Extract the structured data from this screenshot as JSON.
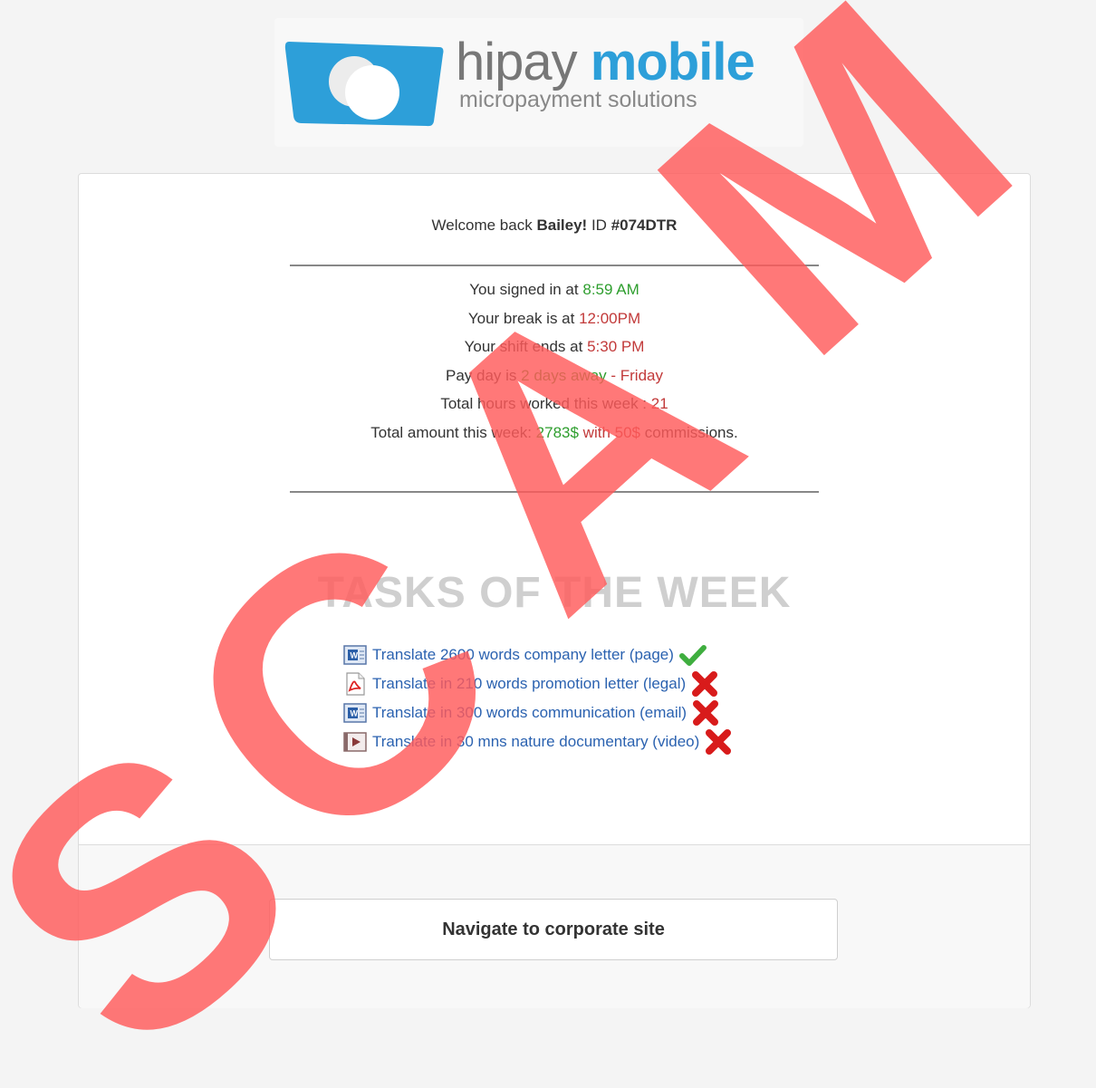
{
  "brand": {
    "word_light": "hipay",
    "word_bold": "mobile",
    "tagline": "micropayment solutions"
  },
  "welcome": {
    "prefix": "Welcome back",
    "name": "Bailey!",
    "id_label": "ID",
    "id_value": "#074DTR"
  },
  "info": {
    "signed_in_label": "You signed in at",
    "signed_in_value": "8:59 AM",
    "break_label": "Your break is at",
    "break_value": "12:00PM",
    "shift_label": "Your shift ends at",
    "shift_value": "5:30 PM",
    "payday_label": "Pay day is",
    "payday_days": "2 days away",
    "payday_sep": " - ",
    "payday_day": "Friday",
    "hours_label": "Total hours worked this week :",
    "hours_value": "21",
    "amount_label": "Total amount this week:",
    "amount_value": "2783$",
    "amount_with": "with",
    "commission_value": "50$",
    "commission_label": "commissions."
  },
  "tasks_heading": "TASKS OF THE WEEK",
  "tasks": [
    {
      "label": "Translate 2600 words company letter (page)",
      "icon": "word-doc-icon",
      "status": "check-icon"
    },
    {
      "label": "Translate in 210 words promotion letter (legal)",
      "icon": "pdf-icon",
      "status": "cross-icon"
    },
    {
      "label": "Translate in 300 words communication (email)",
      "icon": "word-doc-icon",
      "status": "cross-icon"
    },
    {
      "label": "Translate in 30 mns nature documentary (video)",
      "icon": "video-icon",
      "status": "cross-icon"
    }
  ],
  "nav_button": "Navigate to corporate site",
  "watermark": {
    "letters": [
      "S",
      "C",
      "A",
      "M"
    ],
    "color": "#ff5a5a"
  },
  "colors": {
    "brand_blue": "#2d9fd9",
    "green": "#2e9e2e",
    "red": "#c23a3a",
    "link": "#2b62b0"
  }
}
